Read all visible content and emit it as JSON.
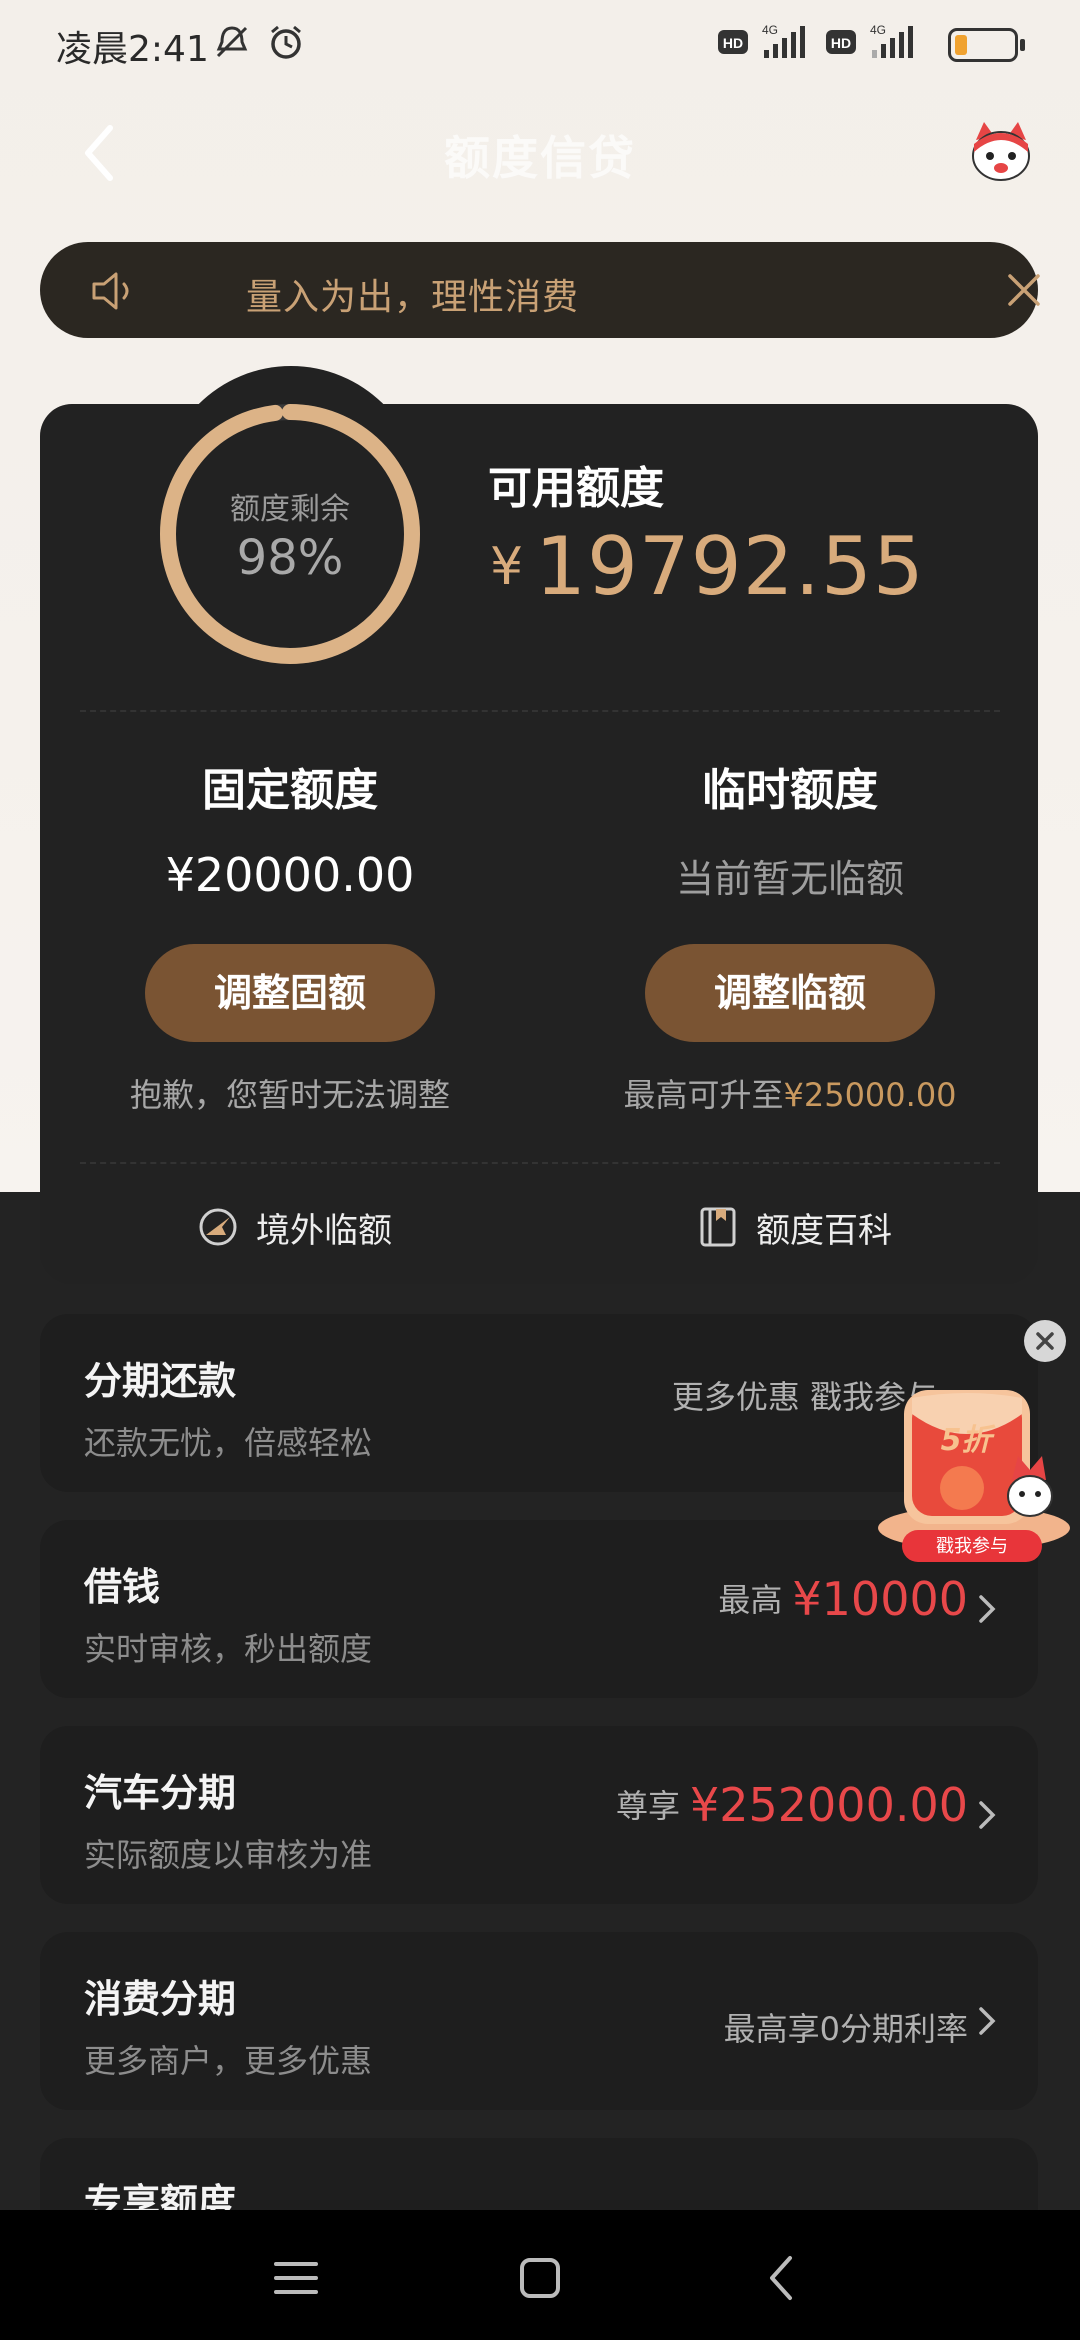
{
  "status_bar": {
    "time": "凌晨2:41",
    "icons": [
      "mute-icon",
      "alarm-icon",
      "hd-icon",
      "4g-signal-icon",
      "hd-icon",
      "4g-signal-icon",
      "battery-icon"
    ],
    "battery_level": 0.2
  },
  "nav": {
    "title": "额度信贷",
    "back_icon": "chevron-left-icon",
    "avatar_icon": "mascot-avatar-icon"
  },
  "notice": {
    "text": "量入为出，理性消费",
    "speaker_icon": "speaker-icon",
    "close_icon": "close-icon"
  },
  "summary": {
    "ring_label": "额度剩余",
    "ring_value": "98%",
    "remaining_fraction": 0.98,
    "available_label": "可用额度",
    "currency": "¥",
    "available_amount": "19792.55"
  },
  "fixed": {
    "title": "固定额度",
    "value": "¥20000.00",
    "button": "调整固额",
    "note": "抱歉，您暂时无法调整"
  },
  "temporary": {
    "title": "临时额度",
    "value": "当前暂无临额",
    "button": "调整临额",
    "note_prefix": "最高可升至",
    "note_amount": "¥25000.00"
  },
  "links": {
    "overseas": "境外临额",
    "wiki": "额度百科"
  },
  "rows": [
    {
      "title": "分期还款",
      "sub": "还款无忧，倍感轻松",
      "right_text": "更多优惠  戳我参与",
      "right_amount": ""
    },
    {
      "title": "借钱",
      "sub": "实时审核，秒出额度",
      "right_text": "最高",
      "right_amount": "¥10000"
    },
    {
      "title": "汽车分期",
      "sub": "实际额度以审核为准",
      "right_text": "尊享",
      "right_amount": "¥252000.00"
    },
    {
      "title": "消费分期",
      "sub": "更多商户，更多优惠",
      "right_text": "最高享0分期利率",
      "right_amount": ""
    },
    {
      "title": "专享额度",
      "sub": "",
      "right_text": "",
      "right_amount": ""
    }
  ],
  "promo": {
    "discount": "5折",
    "cta": "戳我参与"
  },
  "colors": {
    "gold": "#d8ab7c",
    "accent_red": "#e8484a",
    "button_brown": "#7a5433"
  }
}
